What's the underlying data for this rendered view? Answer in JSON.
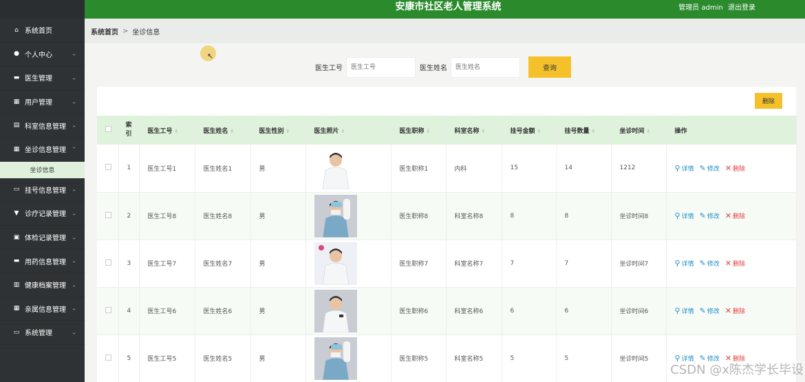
{
  "app": {
    "title": "安康市社区老人管理系统",
    "user_label": "管理员 admin",
    "logout_label": "退出登录"
  },
  "breadcrumb": {
    "home": "系统首页",
    "separator": ">",
    "current": "坐诊信息"
  },
  "sidebar": {
    "items": [
      {
        "label": "系统首页",
        "icon": "home-icon",
        "glyph": "⌂",
        "chevron": ""
      },
      {
        "label": "个人中心",
        "icon": "user-icon",
        "glyph": "●",
        "chevron": "⌄"
      },
      {
        "label": "医生管理",
        "icon": "briefcase-icon",
        "glyph": "▬",
        "chevron": "⌄"
      },
      {
        "label": "用户管理",
        "icon": "grid-icon",
        "glyph": "▦",
        "chevron": "⌄"
      },
      {
        "label": "科室信息管理",
        "icon": "clipboard-icon",
        "glyph": "▤",
        "chevron": "⌄"
      },
      {
        "label": "坐诊信息管理",
        "icon": "grid-icon",
        "glyph": "▦",
        "chevron": "⌃"
      },
      {
        "label": "挂号信息管理",
        "icon": "monitor-icon",
        "glyph": "▭",
        "chevron": "⌄"
      },
      {
        "label": "诊疗记录管理",
        "icon": "funnel-icon",
        "glyph": "▼",
        "chevron": "⌄"
      },
      {
        "label": "体检记录管理",
        "icon": "medkit-icon",
        "glyph": "▣",
        "chevron": "⌄"
      },
      {
        "label": "用药信息管理",
        "icon": "pill-icon",
        "glyph": "▬",
        "chevron": "⌄"
      },
      {
        "label": "健康档案管理",
        "icon": "chart-icon",
        "glyph": "▥",
        "chevron": "⌄"
      },
      {
        "label": "亲属信息管理",
        "icon": "grid-icon",
        "glyph": "▦",
        "chevron": "⌄"
      },
      {
        "label": "系统管理",
        "icon": "monitor-icon",
        "glyph": "▭",
        "chevron": "⌄"
      }
    ],
    "active_submenu": "坐诊信息"
  },
  "search": {
    "doctor_no_label": "医生工号",
    "doctor_no_placeholder": "医生工号",
    "doctor_name_label": "医生姓名",
    "doctor_name_placeholder": "医生姓名",
    "query_label": "查询"
  },
  "toolbar": {
    "delete_label": "删除"
  },
  "table": {
    "columns": [
      "索引",
      "医生工号",
      "医生姓名",
      "医生性别",
      "医生照片",
      "医生职称",
      "科室名称",
      "挂号金额",
      "挂号数量",
      "坐诊时间",
      "操作"
    ],
    "index_header_line1": "索",
    "index_header_line2": "引",
    "rows": [
      {
        "index": "1",
        "doctor_no": "医生工号1",
        "doctor_name": "医生姓名1",
        "gender": "男",
        "title": "医生职称1",
        "dept": "内科",
        "fee": "15",
        "count": "14",
        "time": "1212"
      },
      {
        "index": "2",
        "doctor_no": "医生工号8",
        "doctor_name": "医生姓名8",
        "gender": "男",
        "title": "医生职称8",
        "dept": "科室名称8",
        "fee": "8",
        "count": "8",
        "time": "坐诊时间8"
      },
      {
        "index": "3",
        "doctor_no": "医生工号7",
        "doctor_name": "医生姓名7",
        "gender": "男",
        "title": "医生职称7",
        "dept": "科室名称7",
        "fee": "7",
        "count": "7",
        "time": "坐诊时间7"
      },
      {
        "index": "4",
        "doctor_no": "医生工号6",
        "doctor_name": "医生姓名6",
        "gender": "男",
        "title": "医生职称6",
        "dept": "科室名称6",
        "fee": "6",
        "count": "6",
        "time": "坐诊时间6"
      },
      {
        "index": "5",
        "doctor_no": "医生工号5",
        "doctor_name": "医生姓名5",
        "gender": "男",
        "title": "医生职称5",
        "dept": "科室名称5",
        "fee": "5",
        "count": "5",
        "time": "坐诊时间5"
      }
    ],
    "actions": {
      "detail": "详情",
      "edit": "修改",
      "delete": "删除"
    }
  },
  "watermark": "CSDN @x陈杰学长毕设",
  "colors": {
    "header_green": "#2a8a2c",
    "sidebar_dark": "#2f3234",
    "accent_yellow": "#f5c12b",
    "table_header_green": "#dff3dc",
    "link_blue": "#1e8ec7",
    "delete_red": "#e53b3b"
  }
}
